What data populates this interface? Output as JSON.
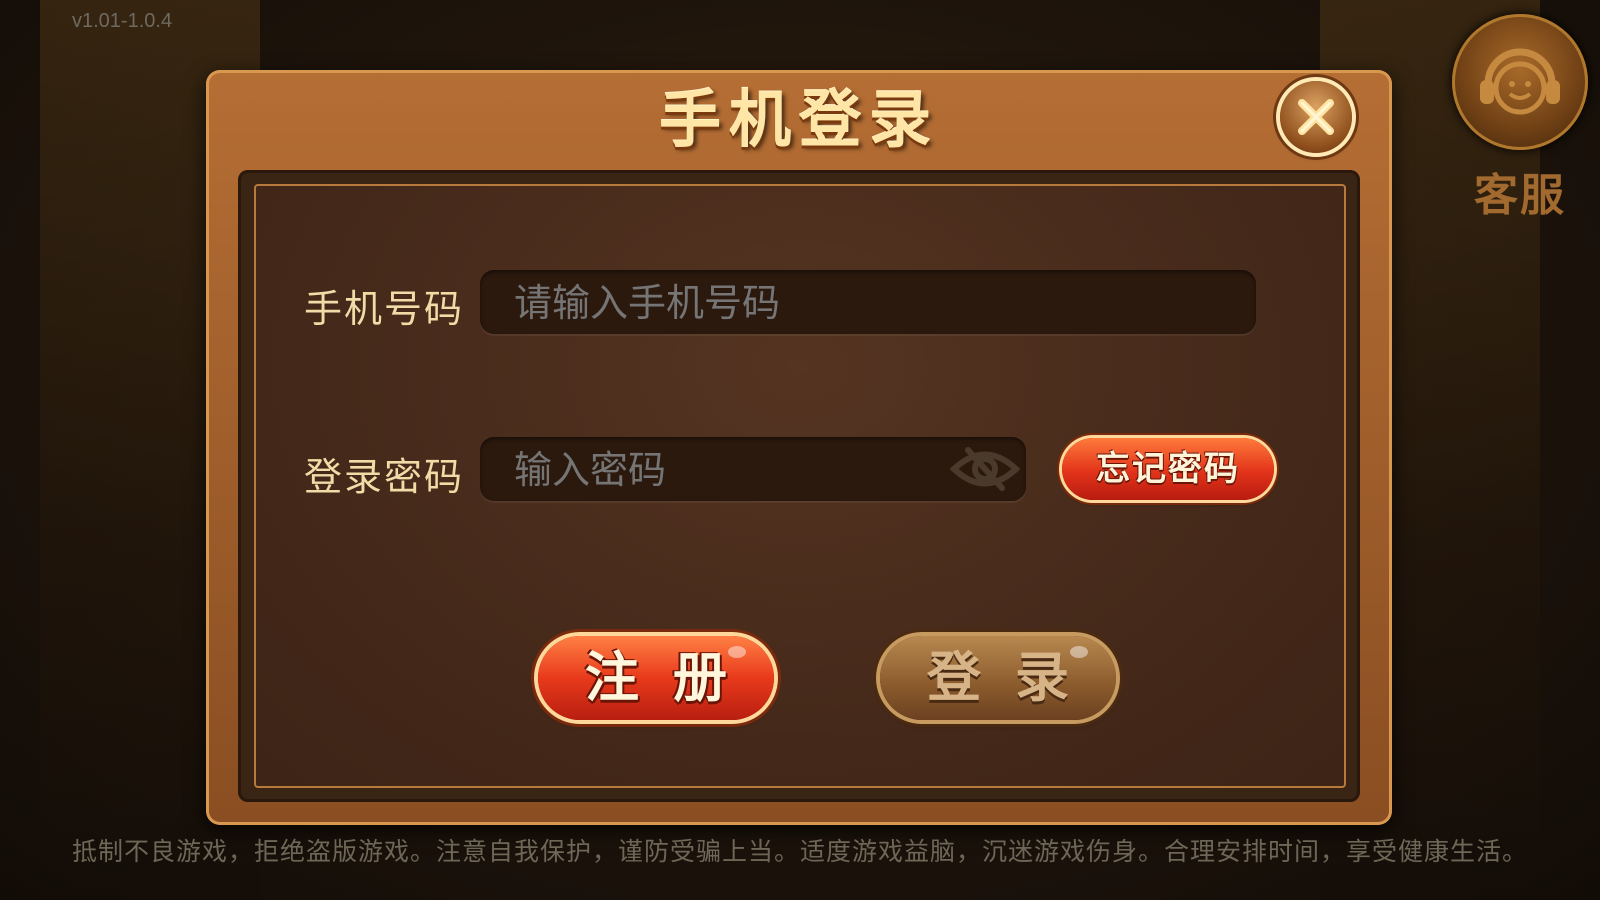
{
  "version": "v1.01-1.0.4",
  "customer_service": {
    "label": "客服",
    "icon": "headset-smiley-icon"
  },
  "dialog": {
    "title": "手机登录",
    "close_icon": "close-icon",
    "phone": {
      "label": "手机号码",
      "placeholder": "请输入手机号码",
      "value": ""
    },
    "password": {
      "label": "登录密码",
      "placeholder": "输入密码",
      "value": "",
      "toggle_icon": "eye-hidden-icon"
    },
    "forgot_label": "忘记密码",
    "register_label": "注册",
    "login_label": "登录"
  },
  "footer_notice": "抵制不良游戏，拒绝盗版游戏。注意自我保护，谨防受骗上当。适度游戏益脑，沉迷游戏伤身。合理安排时间，享受健康生活。",
  "colors": {
    "accent_red": "#e2331a",
    "label_gold": "#f1dba6",
    "frame_brown": "#8a4e22",
    "disabled_login": "#8a5a2c"
  }
}
